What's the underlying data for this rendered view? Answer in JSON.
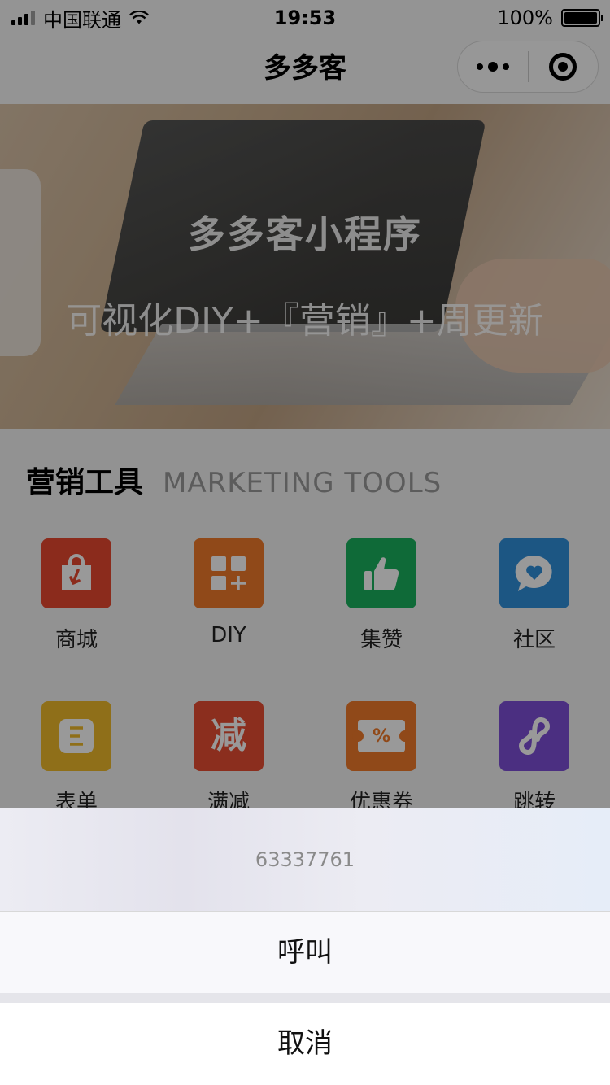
{
  "status_bar": {
    "carrier": "中国联通",
    "time": "19:53",
    "battery": "100%",
    "battery_level": 1.0
  },
  "nav": {
    "title": "多多客"
  },
  "banner": {
    "title": "多多客小程序",
    "subtitle": "可视化DIY+『营销』+周更新"
  },
  "section": {
    "title_zh": "营销工具",
    "title_en": "MARKETING TOOLS",
    "tools": [
      {
        "label": "商城",
        "icon": "shopping-bag-icon",
        "color": "#e8482f"
      },
      {
        "label": "DIY",
        "icon": "diy-grid-plus-icon",
        "color": "#f07a2a"
      },
      {
        "label": "集赞",
        "icon": "thumbs-up-icon",
        "color": "#19b15e"
      },
      {
        "label": "社区",
        "icon": "chat-heart-icon",
        "color": "#2f8fdb"
      },
      {
        "label": "表单",
        "icon": "form-icon",
        "color": "#efba2b"
      },
      {
        "label": "满减",
        "icon": "discount-jian-icon",
        "color": "#e84e33",
        "glyph": "减"
      },
      {
        "label": "优惠券",
        "icon": "coupon-icon",
        "color": "#f07a2a",
        "glyph": "%"
      },
      {
        "label": "跳转",
        "icon": "link-icon",
        "color": "#7d4fd8"
      }
    ]
  },
  "action_sheet": {
    "phone": "63337761",
    "call": "呼叫",
    "cancel": "取消"
  }
}
